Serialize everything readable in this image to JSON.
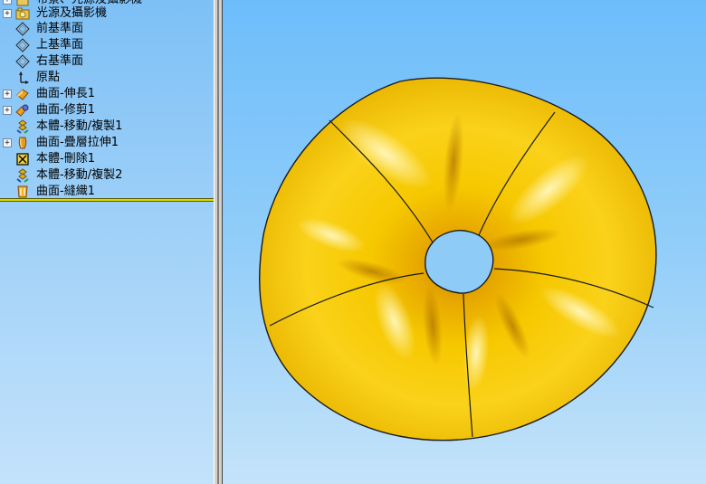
{
  "feature_tree": {
    "items": [
      {
        "label": "布景、光源及攝影機",
        "icon": "folder-scene-icon",
        "expandable": true
      },
      {
        "label": "光源及攝影機",
        "icon": "lights-camera-icon",
        "expandable": true
      },
      {
        "label": "前基準面",
        "icon": "plane-icon",
        "expandable": false
      },
      {
        "label": "上基準面",
        "icon": "plane-icon",
        "expandable": false
      },
      {
        "label": "右基準面",
        "icon": "plane-icon",
        "expandable": false
      },
      {
        "label": "原點",
        "icon": "origin-icon",
        "expandable": false
      },
      {
        "label": "曲面-伸長1",
        "icon": "surface-extrude-icon",
        "expandable": true
      },
      {
        "label": "曲面-修剪1",
        "icon": "surface-trim-icon",
        "expandable": true
      },
      {
        "label": "本體-移動/複製1",
        "icon": "body-move-copy-icon",
        "expandable": false
      },
      {
        "label": "曲面-疊層拉伸1",
        "icon": "surface-loft-icon",
        "expandable": true
      },
      {
        "label": "本體-刪除1",
        "icon": "body-delete-icon",
        "expandable": false
      },
      {
        "label": "本體-移動/複製2",
        "icon": "body-move-copy-icon",
        "expandable": false
      },
      {
        "label": "曲面-縫織1",
        "icon": "surface-knit-icon",
        "expandable": false
      }
    ]
  },
  "viewport": {
    "model": "torus-surface",
    "surface_color": "#f5c400",
    "edge_color": "#1a1a1a"
  },
  "colors": {
    "tree_background_top": "#7dc0f6",
    "viewport_background_top": "#6dbdfb",
    "rollback_bar": "#ddd800"
  }
}
